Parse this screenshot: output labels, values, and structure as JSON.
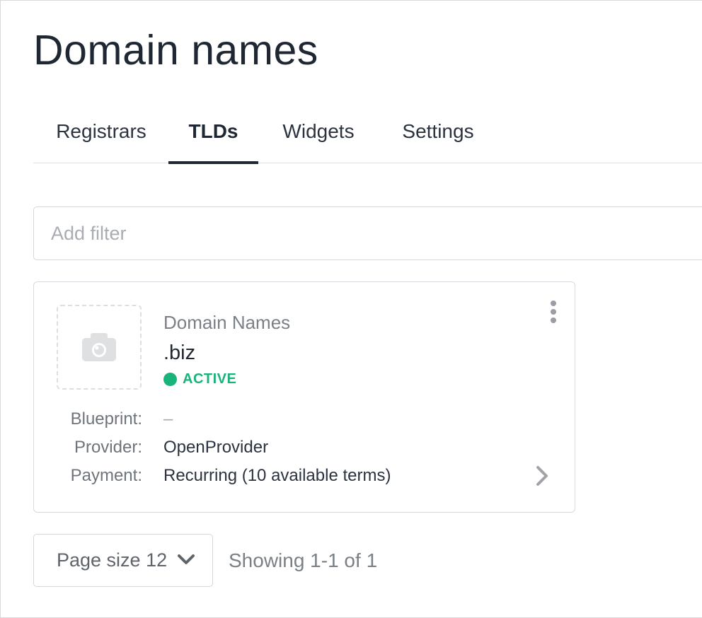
{
  "page": {
    "title": "Domain names"
  },
  "tabs": [
    {
      "label": "Registrars",
      "active": false
    },
    {
      "label": "TLDs",
      "active": true
    },
    {
      "label": "Widgets",
      "active": false
    },
    {
      "label": "Settings",
      "active": false
    }
  ],
  "filter": {
    "placeholder": "Add filter",
    "value": ""
  },
  "card": {
    "image_icon": "camera-icon",
    "category": "Domain Names",
    "name": ".biz",
    "status": "ACTIVE",
    "status_color": "#18b47a",
    "menu_icon": "kebab-menu-icon",
    "blueprint_label": "Blueprint:",
    "blueprint_value": "–",
    "provider_label": "Provider:",
    "provider_value": "OpenProvider",
    "payment_label": "Payment:",
    "payment_value": "Recurring (10 available terms)",
    "open_icon": "chevron-right-icon"
  },
  "pagination": {
    "page_size_label": "Page size 12",
    "dropdown_icon": "chevron-down-icon",
    "showing_text": "Showing 1-1 of 1"
  }
}
